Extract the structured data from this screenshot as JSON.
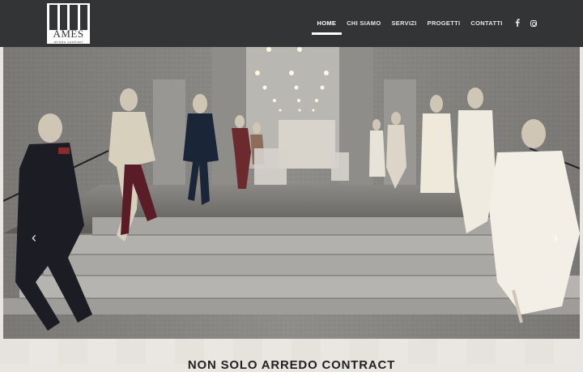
{
  "header": {
    "logo": {
      "word": "AMES",
      "tagline": "arredo contract"
    },
    "nav": [
      {
        "label": "HOME",
        "active": true
      },
      {
        "label": "CHI SIAMO",
        "active": false
      },
      {
        "label": "SERVIZI",
        "active": false
      },
      {
        "label": "PROGETTI",
        "active": false
      },
      {
        "label": "CONTATTI",
        "active": false
      }
    ],
    "social": [
      {
        "icon": "facebook-icon"
      },
      {
        "icon": "instagram-icon"
      }
    ]
  },
  "slider": {
    "image": "boutique-interior-mannequins-stairs",
    "prev_arrow": "‹",
    "next_arrow": "›"
  },
  "section": {
    "headline": "NON SOLO ARREDO CONTRACT"
  },
  "colors": {
    "header_bg": "#333436",
    "nav_text": "#e6e6e6",
    "active_underline": "#ffffff"
  }
}
